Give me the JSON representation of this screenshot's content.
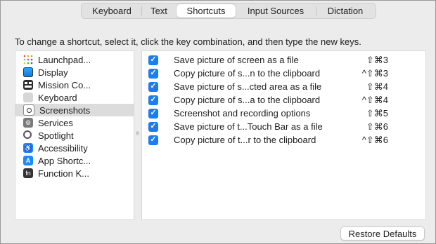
{
  "tabs": [
    {
      "label": "Keyboard"
    },
    {
      "label": "Text"
    },
    {
      "label": "Shortcuts",
      "selected": true
    },
    {
      "label": "Input Sources"
    },
    {
      "label": "Dictation"
    }
  ],
  "instruction": "To change a shortcut, select it, click the key combination, and then type the new keys.",
  "categories": [
    {
      "label": "Launchpad...",
      "icon": "launchpad-icon"
    },
    {
      "label": "Display",
      "icon": "display-icon"
    },
    {
      "label": "Mission Co...",
      "icon": "mission-control-icon"
    },
    {
      "label": "Keyboard",
      "icon": "keyboard-icon"
    },
    {
      "label": "Screenshots",
      "icon": "screenshots-icon",
      "selected": true
    },
    {
      "label": "Services",
      "icon": "gear-icon"
    },
    {
      "label": "Spotlight",
      "icon": "magnifier-icon"
    },
    {
      "label": "Accessibility",
      "icon": "accessibility-icon"
    },
    {
      "label": "App Shortc...",
      "icon": "app-shortcuts-icon"
    },
    {
      "label": "Function K...",
      "icon": "fn-key-icon",
      "glyph": "fn"
    }
  ],
  "shortcuts": [
    {
      "checked": true,
      "name": "Save picture of screen as a file",
      "keys": "⇧⌘3"
    },
    {
      "checked": true,
      "name": "Copy picture of s...n to the clipboard",
      "keys": "^⇧⌘3"
    },
    {
      "checked": true,
      "name": "Save picture of s...cted area as a file",
      "keys": "⇧⌘4"
    },
    {
      "checked": true,
      "name": "Copy picture of s...a to the clipboard",
      "keys": "^⇧⌘4"
    },
    {
      "checked": true,
      "name": "Screenshot and recording options",
      "keys": "⇧⌘5"
    },
    {
      "checked": true,
      "name": "Save picture of t...Touch Bar as a file",
      "keys": "⇧⌘6"
    },
    {
      "checked": true,
      "name": "Copy picture of t...r to the clipboard",
      "keys": "^⇧⌘6"
    }
  ],
  "restore_button": "Restore Defaults",
  "colors": {
    "accent": "#1a7df4",
    "window_bg": "#ececec",
    "selection": "#dcdcdc"
  }
}
